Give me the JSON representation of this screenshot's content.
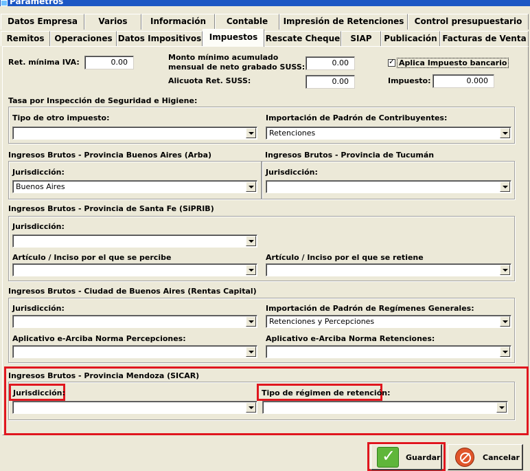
{
  "window": {
    "title": "Parametros"
  },
  "tabs_row1": [
    "Datos Empresa",
    "Varios",
    "Información",
    "Contable",
    "Impresión de Retenciones",
    "Control presupuestario"
  ],
  "tabs_row2": [
    "Remitos",
    "Operaciones",
    "Datos Impositivos",
    "Impuestos",
    "Rescate Cheque",
    "SIAP",
    "Publicación",
    "Facturas de Venta"
  ],
  "active_tab": "Impuestos",
  "top": {
    "ret_minima_iva_label": "Ret. mínima IVA:",
    "ret_minima_iva_value": "0.00",
    "monto_minimo_label_1": "Monto mínimo acumulado",
    "monto_minimo_label_2": "mensual de neto grabado SUSS:",
    "monto_minimo_value": "0.00",
    "alicuota_label": "Alicuota Ret. SUSS:",
    "alicuota_value": "0.00",
    "aplica_label": "Aplica Impuesto bancario",
    "aplica_checked": true,
    "impuesto_label": "Impuesto:",
    "impuesto_value": "0.000"
  },
  "tasa": {
    "title": "Tasa por Inspección de Seguridad e Higiene:",
    "tipo_label": "Tipo de otro impuesto:",
    "tipo_value": "",
    "importacion_label": "Importación de Padrón de Contribuyentes:",
    "importacion_value": "Retenciones"
  },
  "arba": {
    "title": "Ingresos Brutos - Provincia Buenos Aires (Arba)",
    "jurisdiccion_label": "Jurisdicción:",
    "jurisdiccion_value": "Buenos Aires"
  },
  "tucuman": {
    "title": "Ingresos Brutos - Provincia de Tucumán",
    "jurisdiccion_label": "Jurisdicción:",
    "jurisdiccion_value": ""
  },
  "santafe": {
    "title": "Ingresos Brutos - Provincia de Santa Fe (SiPRIB)",
    "jurisdiccion_label": "Jurisdicción:",
    "articulo_percibe_label": "Artículo / Inciso por el que se percibe",
    "articulo_retiene_label": "Artículo / Inciso por el que se retiene"
  },
  "caba": {
    "title": "Ingresos Brutos - Ciudad de Buenos Aires (Rentas Capital)",
    "jurisdiccion_label": "Jurisdicción:",
    "importacion_label": "Importación de Padrón de Regímenes Generales:",
    "importacion_value": "Retenciones y Percepciones",
    "aplicativo_perc_label": "Aplicativo e-Arciba Norma Percepciones:",
    "aplicativo_ret_label": "Aplicativo e-Arciba Norma Retenciones:"
  },
  "mendoza": {
    "title": "Ingresos Brutos - Provincia Mendoza (SICAR)",
    "jurisdiccion_label": "Jurisdicción:",
    "tipo_regimen_label": "Tipo de régimen de retención:"
  },
  "buttons": {
    "guardar": "Guardar",
    "cancelar": "Cancelar"
  },
  "colors": {
    "highlight": "#e0161e",
    "background": "#ece9d8"
  }
}
